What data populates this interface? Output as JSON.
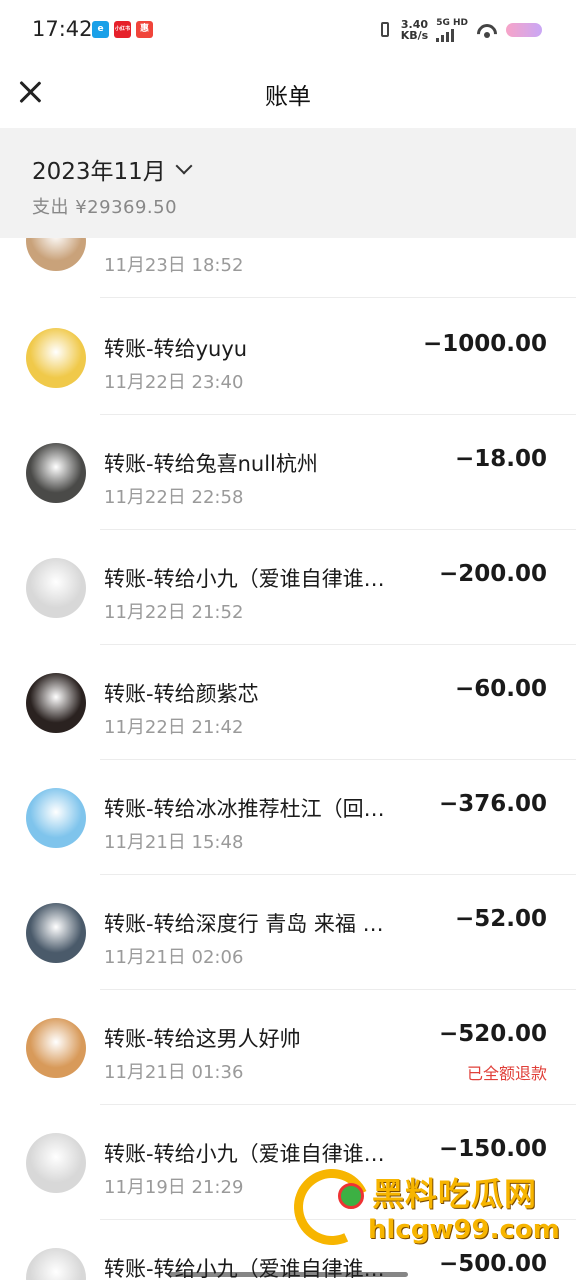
{
  "status_bar": {
    "time": "17:42",
    "apps": [
      {
        "icon": "app-icon-blue",
        "color": "#1aa0e8",
        "text": "e"
      },
      {
        "icon": "app-icon-red",
        "color": "#e6202a",
        "text": "小红书"
      },
      {
        "icon": "app-icon-orange",
        "color": "#f0443a",
        "text": "惠"
      }
    ],
    "speed_value": "3.40",
    "speed_unit": "KB/s",
    "network": "5G HD"
  },
  "nav": {
    "title": "账单"
  },
  "summary": {
    "month": "2023年11月",
    "total": "支出 ¥29369.50"
  },
  "transactions": [
    {
      "name": "",
      "time": "11月23日 18:52",
      "amount": "",
      "refund": "",
      "avatar_color": "#c9a27a"
    },
    {
      "name": "转账-转给yuyu",
      "time": "11月22日 23:40",
      "amount": "−1000.00",
      "refund": "",
      "avatar_color": "#f0c94a"
    },
    {
      "name": "转账-转给兔喜null杭州",
      "time": "11月22日 22:58",
      "amount": "−18.00",
      "refund": "",
      "avatar_color": "#4a4a48"
    },
    {
      "name": "转账-转给小九（爱谁自律谁…",
      "time": "11月22日 21:52",
      "amount": "−200.00",
      "refund": "",
      "avatar_color": "#d8d8d8"
    },
    {
      "name": "转账-转给颜紫芯",
      "time": "11月22日 21:42",
      "amount": "−60.00",
      "refund": "",
      "avatar_color": "#2a2220"
    },
    {
      "name": "转账-转给冰冰推荐杜江（回…",
      "time": "11月21日 15:48",
      "amount": "−376.00",
      "refund": "",
      "avatar_color": "#7fc4ec"
    },
    {
      "name": "转账-转给深度行 青岛 来福 …",
      "time": "11月21日 02:06",
      "amount": "−52.00",
      "refund": "",
      "avatar_color": "#4a5a6a"
    },
    {
      "name": "转账-转给这男人好帅",
      "time": "11月21日 01:36",
      "amount": "−520.00",
      "refund": "已全额退款",
      "avatar_color": "#d89a5a"
    },
    {
      "name": "转账-转给小九（爱谁自律谁…",
      "time": "11月19日 21:29",
      "amount": "−150.00",
      "refund": "",
      "avatar_color": "#d8d8d8"
    },
    {
      "name": "转账-转给小九（爱谁自律谁…",
      "time": "",
      "amount": "−500.00",
      "refund": "",
      "avatar_color": "#d8d8d8"
    }
  ],
  "watermark": {
    "line1": "黑料吃瓜网",
    "line2": "hlcgw99.com"
  },
  "colors": {
    "refund": "#e0403a",
    "summary_bg": "#f2f2f2",
    "watermark": "#f7b500"
  }
}
